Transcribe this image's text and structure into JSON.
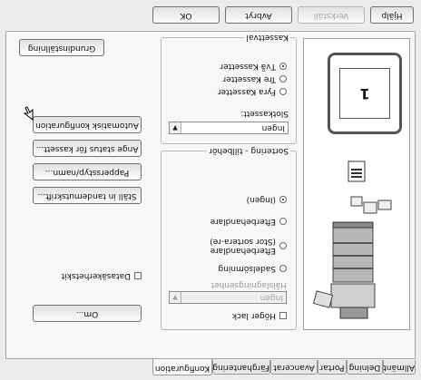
{
  "dialog_buttons": {
    "ok": "OK",
    "cancel": "Avbryt",
    "apply": "Verkställ",
    "help": "Hjälp"
  },
  "tabs": [
    "Allmänt",
    "Delning",
    "Portar",
    "Avancerat",
    "Färghantering",
    "Konfiguration"
  ],
  "active_tab": "Konfiguration",
  "kassettval": {
    "label": "Kassettval",
    "options": [
      "Två Kassetter",
      "Tre Kassetter",
      "Fyra Kassetter"
    ],
    "selected": "Två Kassetter"
  },
  "slots": {
    "label": "Slotkassett:",
    "value": "Ingen"
  },
  "sortering": {
    "label": "Sortering - tillbehör",
    "options": [
      "(Ingen)",
      "Efterbehandlare",
      "Efterbehandlare (Stor sortera-re)",
      "Sadelsömning"
    ],
    "selected": "(Ingen)",
    "halslag_label": "Hålslagningsenhet",
    "halslag_value": "Ingen",
    "hoger_lack": "Höger lack"
  },
  "datasakerhet": "Datasäkerhetskit",
  "buttons": {
    "auto": "Automatisk konfiguration",
    "status": "Ange status för kassett...",
    "papper": "Pappersstyp/namn...",
    "tandem": "Ställ in tandemutskrift...",
    "om": "Om...",
    "grund": "Grundinställning"
  },
  "tray_number": "1"
}
